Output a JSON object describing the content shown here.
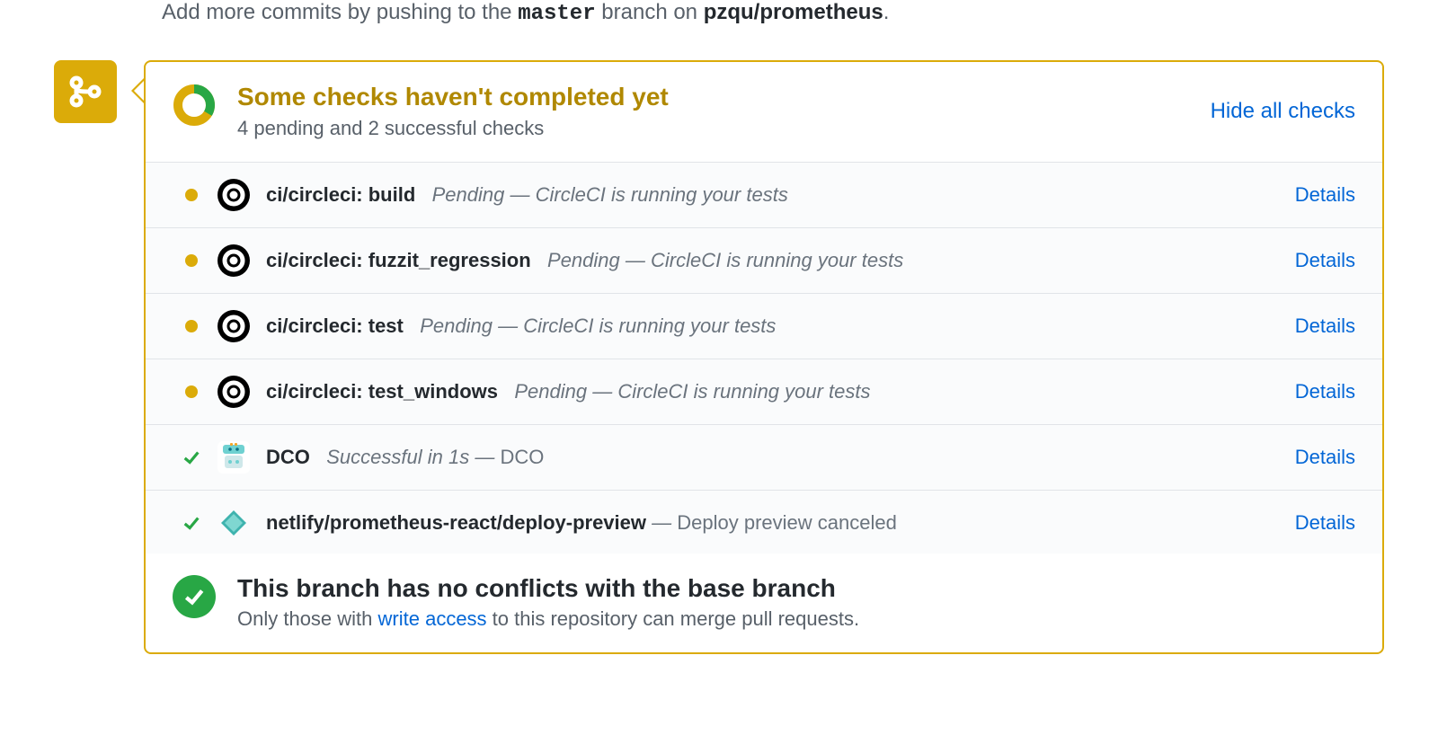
{
  "hint": {
    "prefix": "Add more commits by pushing to the ",
    "branch": "master",
    "mid": " branch on ",
    "repo": "pzqu/prometheus",
    "suffix": "."
  },
  "summary": {
    "title": "Some checks haven't completed yet",
    "subtitle": "4 pending and 2 successful checks",
    "toggle": "Hide all checks"
  },
  "checks": [
    {
      "status": "pending",
      "avatar": "circleci",
      "name": "ci/circleci: build",
      "statusText": "Pending",
      "msg": "CircleCI is running your tests",
      "msgItalic": true,
      "details": "Details"
    },
    {
      "status": "pending",
      "avatar": "circleci",
      "name": "ci/circleci: fuzzit_regression",
      "statusText": "Pending",
      "msg": "CircleCI is running your tests",
      "msgItalic": true,
      "details": "Details"
    },
    {
      "status": "pending",
      "avatar": "circleci",
      "name": "ci/circleci: test",
      "statusText": "Pending",
      "msg": "CircleCI is running your tests",
      "msgItalic": true,
      "details": "Details"
    },
    {
      "status": "pending",
      "avatar": "circleci",
      "name": "ci/circleci: test_windows",
      "statusText": "Pending",
      "msg": "CircleCI is running your tests",
      "msgItalic": true,
      "details": "Details"
    },
    {
      "status": "success",
      "avatar": "dco",
      "name": "DCO",
      "statusText": "Successful in 1s",
      "msg": "DCO",
      "msgItalic": false,
      "details": "Details"
    },
    {
      "status": "success",
      "avatar": "netlify",
      "name": "netlify/prometheus-react/deploy-preview",
      "statusText": "",
      "msg": "Deploy preview canceled",
      "msgItalic": false,
      "details": "Details"
    }
  ],
  "conflicts": {
    "title": "This branch has no conflicts with the base branch",
    "sub_pre": "Only those with ",
    "sub_link": "write access",
    "sub_post": " to this repository can merge pull requests."
  }
}
